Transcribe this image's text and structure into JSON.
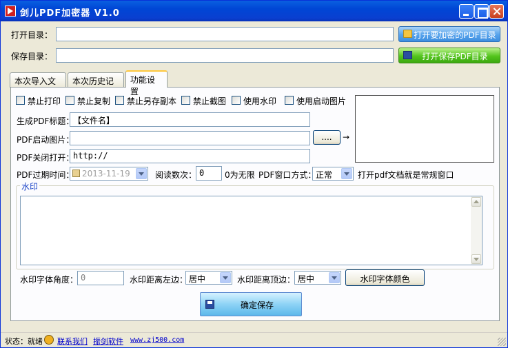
{
  "window": {
    "title": "剑儿PDF加密器   V1.0"
  },
  "top_form": {
    "open_dir_label": "打开目录：",
    "open_dir_value": "",
    "open_dir_button": "打开要加密的PDF目录",
    "save_dir_label": "保存目录：",
    "save_dir_value": "",
    "save_dir_button": "打开保存PDF目录"
  },
  "tabs": [
    {
      "label": "本次导入文件",
      "active": false
    },
    {
      "label": "本次历史记录",
      "active": false
    },
    {
      "label": "功能设置",
      "active": true
    }
  ],
  "settings": {
    "checkboxes": [
      {
        "label": "禁止打印",
        "checked": false
      },
      {
        "label": "禁止复制",
        "checked": false
      },
      {
        "label": "禁止另存副本",
        "checked": false
      },
      {
        "label": "禁止截图",
        "checked": false
      },
      {
        "label": "使用水印",
        "checked": false
      },
      {
        "label": "使用启动图片",
        "checked": false
      }
    ],
    "pdf_title_label": "生成PDF标题：",
    "pdf_title_value": "【文件名】",
    "startup_image_label": "PDF启动图片：",
    "startup_image_value": "",
    "browse_button": "....",
    "arrow": "→",
    "close_open_label": "PDF关闭打开：",
    "close_open_value": "http://",
    "expire_label": "PDF过期时间：",
    "expire_value": "2013-11-19",
    "read_count_label": "阅读数次：",
    "read_count_value": "0",
    "read_count_hint": "0为无限",
    "window_mode_label": "PDF窗口方式：",
    "window_mode_value": "正常",
    "window_mode_hint": "打开pdf文档就是常规窗口"
  },
  "watermark": {
    "group_title": "水印",
    "text_value": "",
    "angle_label": "水印字体角度：",
    "angle_value": "0",
    "left_label": "水印距离左边：",
    "left_value": "居中",
    "top_label": "水印距离顶边：",
    "top_value": "居中",
    "color_button": "水印字体颜色"
  },
  "save_button": "确定保存",
  "statusbar": {
    "status": "状态：就绪",
    "contact_link": "联系我们",
    "software_link": "振剑软件",
    "url": "www.zj500.com"
  }
}
